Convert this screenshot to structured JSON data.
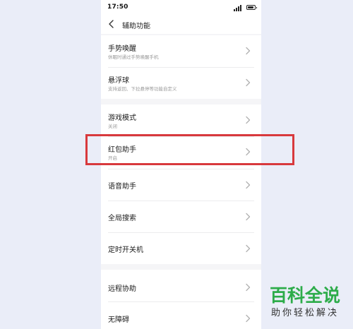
{
  "status_bar": {
    "time": "17:50",
    "signal_icon": "signal-bars-icon",
    "battery_icon": "battery-icon"
  },
  "nav": {
    "back_icon": "chevron-left-icon",
    "title": "辅助功能"
  },
  "groups": [
    {
      "items": [
        {
          "title": "手势唤醒",
          "subtitle": "休眠时通过手势唤醒手机"
        },
        {
          "title": "悬浮球",
          "subtitle": "支持返回、下拉悬停等功能自定义"
        }
      ]
    },
    {
      "items": [
        {
          "title": "游戏模式",
          "subtitle": "关闭"
        },
        {
          "title": "红包助手",
          "subtitle": "开启"
        },
        {
          "title": "语音助手",
          "subtitle": ""
        },
        {
          "title": "全局搜索",
          "subtitle": ""
        },
        {
          "title": "定时开关机",
          "subtitle": ""
        }
      ]
    },
    {
      "items": [
        {
          "title": "远程协助",
          "subtitle": ""
        },
        {
          "title": "无障碍",
          "subtitle": ""
        }
      ]
    }
  ],
  "chevron_icon": "chevron-right-icon",
  "highlight": {
    "target": "红包助手",
    "color": "#d8393d"
  },
  "watermark": {
    "main": "百科全说",
    "sub": "助你轻松解决",
    "color": "#2dac4a"
  },
  "colors": {
    "page_background": "#eaedf8",
    "list_background": "#ffffff",
    "separator_background": "#f5f5f7"
  }
}
